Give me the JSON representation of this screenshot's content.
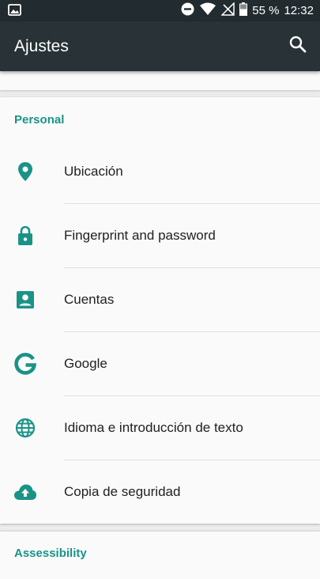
{
  "status_bar": {
    "battery_percent": "55 %",
    "time": "12:32"
  },
  "app_bar": {
    "title": "Ajustes",
    "search_icon": "search-icon"
  },
  "colors": {
    "accent": "#1a9387",
    "app_bar": "#283237",
    "status_bar": "#222b2f"
  },
  "sections": [
    {
      "header": "Personal",
      "items": [
        {
          "label": "Ubicación",
          "icon": "location-pin-icon"
        },
        {
          "label": "Fingerprint and password",
          "icon": "lock-icon"
        },
        {
          "label": "Cuentas",
          "icon": "account-box-icon"
        },
        {
          "label": "Google",
          "icon": "google-icon"
        },
        {
          "label": "Idioma e introducción de texto",
          "icon": "globe-icon"
        },
        {
          "label": "Copia de seguridad",
          "icon": "cloud-upload-icon"
        }
      ]
    },
    {
      "header": "Assessibility",
      "items": []
    }
  ]
}
